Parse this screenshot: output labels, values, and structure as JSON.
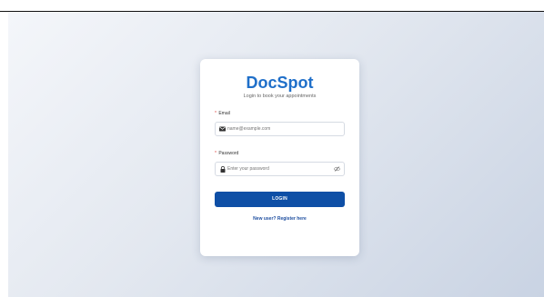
{
  "brand": {
    "title": "DocSpot",
    "subtitle": "Login to book your appointments"
  },
  "form": {
    "email_label": "Email",
    "email_placeholder": "name@example.com",
    "password_label": "Password",
    "password_placeholder": "Enter your password",
    "required_marker": "*",
    "login_label": "LOGIN",
    "register_link": "New user? Register here"
  },
  "icons": {
    "email": "envelope-icon",
    "password": "lock-icon",
    "toggle_visibility": "eye-slash-icon"
  },
  "colors": {
    "brand": "#1f6fc9",
    "button": "#0e4fa6",
    "link": "#1f4fa0",
    "required": "#e0443e"
  }
}
